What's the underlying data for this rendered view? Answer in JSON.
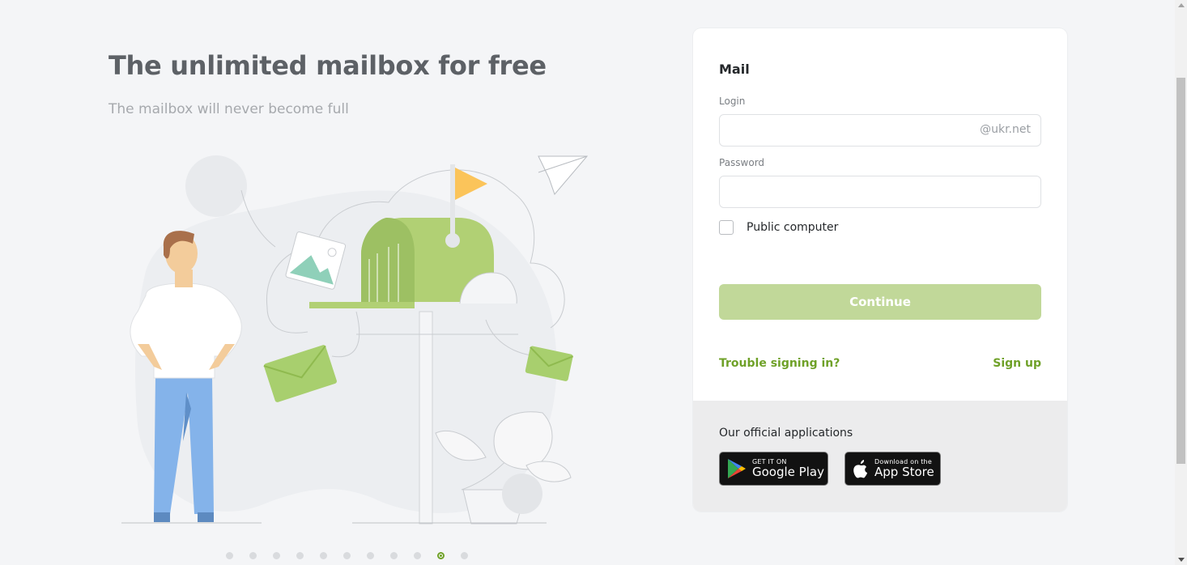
{
  "promo": {
    "title": "The unlimited mailbox for free",
    "subtitle": "The mailbox will never become full",
    "slides_count": 11,
    "active_slide": 9
  },
  "login_card": {
    "title": "Mail",
    "login_label": "Login",
    "login_value": "",
    "login_suffix": "@ukr.net",
    "password_label": "Password",
    "password_value": "",
    "public_computer_label": "Public computer",
    "public_computer_checked": false,
    "continue_label": "Continue",
    "trouble_label": "Trouble signing in?",
    "signup_label": "Sign up"
  },
  "apps": {
    "title": "Our official applications",
    "google_play": {
      "small": "GET IT ON",
      "big": "Google Play"
    },
    "app_store": {
      "small": "Download on the",
      "big": "App Store"
    }
  },
  "colors": {
    "accent": "#6fa128",
    "continue_bg": "#c1d899",
    "page_bg": "#f4f5f7",
    "mailbox": "#b1d074"
  }
}
